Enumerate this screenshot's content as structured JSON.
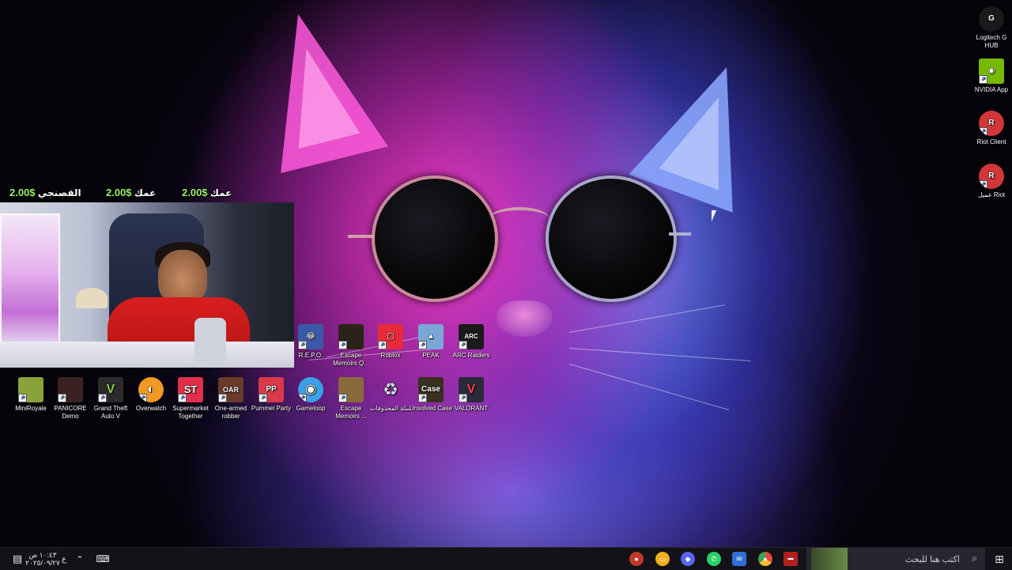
{
  "overlay": {
    "items": [
      {
        "amount": "2.00$",
        "name": "القصنجي"
      },
      {
        "amount": "2.00$",
        "name": "عمك"
      },
      {
        "amount": "2.00$",
        "name": "عمك"
      }
    ]
  },
  "right_icons": [
    {
      "label": "Logitech G HUB",
      "icon": "logitech-g-icon",
      "color": "#1a1a1a"
    },
    {
      "label": "NVIDIA App",
      "icon": "nvidia-icon",
      "color": "#76b900"
    },
    {
      "label": "Riot Client",
      "icon": "riot-icon",
      "color": "#d13639"
    },
    {
      "label": "عميل Riot",
      "icon": "riot-icon",
      "color": "#d13639"
    }
  ],
  "mid_icons": [
    {
      "label": "R.E.P.O.",
      "icon": "repo-icon",
      "color": "#3a5aa8",
      "glyph": "😂"
    },
    {
      "label": "Escape Memoirs Q...",
      "icon": "escape-memoirs-icon",
      "color": "#2a2418",
      "glyph": ""
    },
    {
      "label": "Roblox",
      "icon": "roblox-icon",
      "color": "#e62a3a",
      "glyph": "▢"
    },
    {
      "label": "PEAK",
      "icon": "peak-icon",
      "color": "#79a8d8",
      "glyph": "▲"
    },
    {
      "label": "ARC Raiders",
      "icon": "arc-raiders-icon",
      "color": "#1a1a1a",
      "glyph": "ARC"
    }
  ],
  "bottom_icons": [
    {
      "label": "MiniRoyale",
      "icon": "miniroyale-icon",
      "color": "#8aa23a",
      "glyph": ""
    },
    {
      "label": "PANICORE Demo",
      "icon": "panicore-icon",
      "color": "#3a2222",
      "glyph": ""
    },
    {
      "label": "Grand Theft Auto V",
      "icon": "gta-v-icon",
      "color": "#2b2b2b",
      "glyph": "V"
    },
    {
      "label": "Overwatch",
      "icon": "overwatch-icon",
      "color": "#f09a24",
      "glyph": "◐"
    },
    {
      "label": "Supermarket Together",
      "icon": "supermarket-together-icon",
      "color": "#e0304a",
      "glyph": "ST"
    },
    {
      "label": "One-armed robber",
      "icon": "one-armed-robber-icon",
      "color": "#6a3a2a",
      "glyph": "OAR"
    },
    {
      "label": "Pummel Party",
      "icon": "pummel-party-icon",
      "color": "#d83a4a",
      "glyph": "PP"
    },
    {
      "label": "Gameloop",
      "icon": "gameloop-icon",
      "color": "#3aa0e8",
      "glyph": "◉"
    },
    {
      "label": "Escape Memoirs ...",
      "icon": "escape-memoirs-icon",
      "color": "#8a6a3a",
      "glyph": ""
    },
    {
      "label": "سلة المحذوفات",
      "icon": "recycle-bin-icon",
      "color": "#cfd8e6",
      "glyph": "♻"
    },
    {
      "label": "Unsolved Case",
      "icon": "unsolved-case-icon",
      "color": "#3a3020",
      "glyph": "Case"
    },
    {
      "label": "VALORANT",
      "icon": "valorant-icon",
      "color": "#2a2a3a",
      "glyph": "V"
    }
  ],
  "taskbar": {
    "search_placeholder": "اكتب هنا للبحث",
    "clock_time": "١٠:٤٣ ص",
    "clock_date": "٢٠٢٥/٠٩/٢٧",
    "lang": "ع",
    "apps": [
      {
        "name": "app-1",
        "color": "#c0392b"
      },
      {
        "name": "app-2",
        "color": "#f2b01e"
      },
      {
        "name": "app-3",
        "color": "#5865f2"
      },
      {
        "name": "whatsapp",
        "color": "#25d366"
      },
      {
        "name": "app-5",
        "color": "#2f6fd6"
      },
      {
        "name": "chrome",
        "color": "#e8453c"
      },
      {
        "name": "app-7",
        "color": "#b02020"
      }
    ]
  }
}
